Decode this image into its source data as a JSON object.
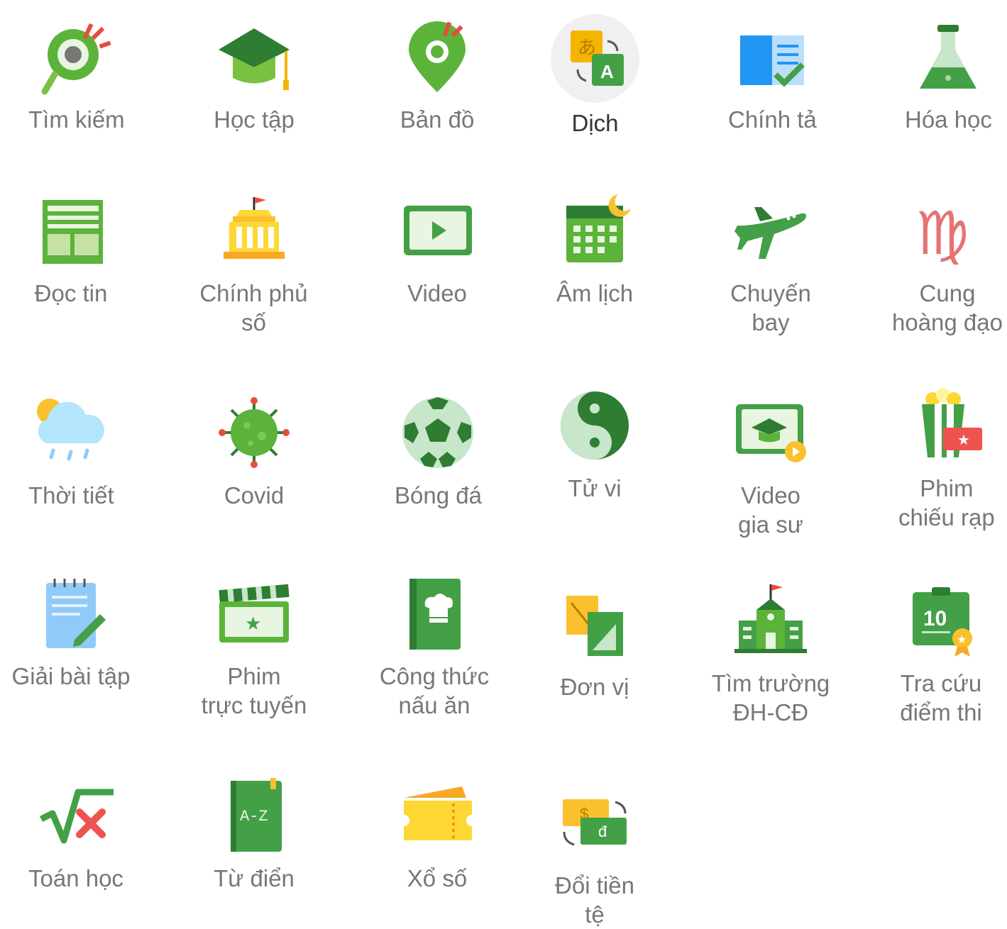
{
  "apps": [
    {
      "label": "Tìm kiếm",
      "icon": "search-map-icon"
    },
    {
      "label": "Học tập",
      "icon": "graduation-cap-icon"
    },
    {
      "label": "Bản đồ",
      "icon": "map-pin-icon"
    },
    {
      "label": "Dịch",
      "icon": "translate-icon",
      "active": true
    },
    {
      "label": "Chính tả",
      "icon": "spellcheck-book-icon"
    },
    {
      "label": "Hóa học",
      "icon": "chemistry-flask-icon"
    },
    {
      "label": "Đọc tin",
      "icon": "newspaper-icon"
    },
    {
      "label": "Chính phủ\nsố",
      "icon": "government-building-icon"
    },
    {
      "label": "Video",
      "icon": "video-play-icon"
    },
    {
      "label": "Âm lịch",
      "icon": "lunar-calendar-icon"
    },
    {
      "label": "Chuyến bay",
      "icon": "airplane-icon"
    },
    {
      "label": "Cung\nhoàng đạo",
      "icon": "zodiac-virgo-icon"
    },
    {
      "label": "Thời tiết",
      "icon": "weather-cloud-icon"
    },
    {
      "label": "Covid",
      "icon": "virus-icon"
    },
    {
      "label": "Bóng đá",
      "icon": "soccer-ball-icon"
    },
    {
      "label": "Tử vi",
      "icon": "yin-yang-icon"
    },
    {
      "label": "Video\ngia sư",
      "icon": "video-tutor-icon"
    },
    {
      "label": "Phim\nchiếu rạp",
      "icon": "popcorn-ticket-icon"
    },
    {
      "label": "Giải bài tập",
      "icon": "notepad-pencil-icon"
    },
    {
      "label": "Phim\ntrực tuyến",
      "icon": "clapperboard-icon"
    },
    {
      "label": "Công thức\nnấu ăn",
      "icon": "recipe-book-icon"
    },
    {
      "label": "Đơn vị",
      "icon": "unit-convert-icon"
    },
    {
      "label": "Tìm trường\nĐH-CĐ",
      "icon": "school-building-icon"
    },
    {
      "label": "Tra cứu\nđiểm thi",
      "icon": "exam-score-icon"
    },
    {
      "label": "Toán học",
      "icon": "math-sqrt-icon"
    },
    {
      "label": "Từ điển",
      "icon": "dictionary-az-icon"
    },
    {
      "label": "Xổ số",
      "icon": "lottery-ticket-icon"
    },
    {
      "label": "Đổi tiền tệ",
      "icon": "currency-exchange-icon"
    }
  ]
}
